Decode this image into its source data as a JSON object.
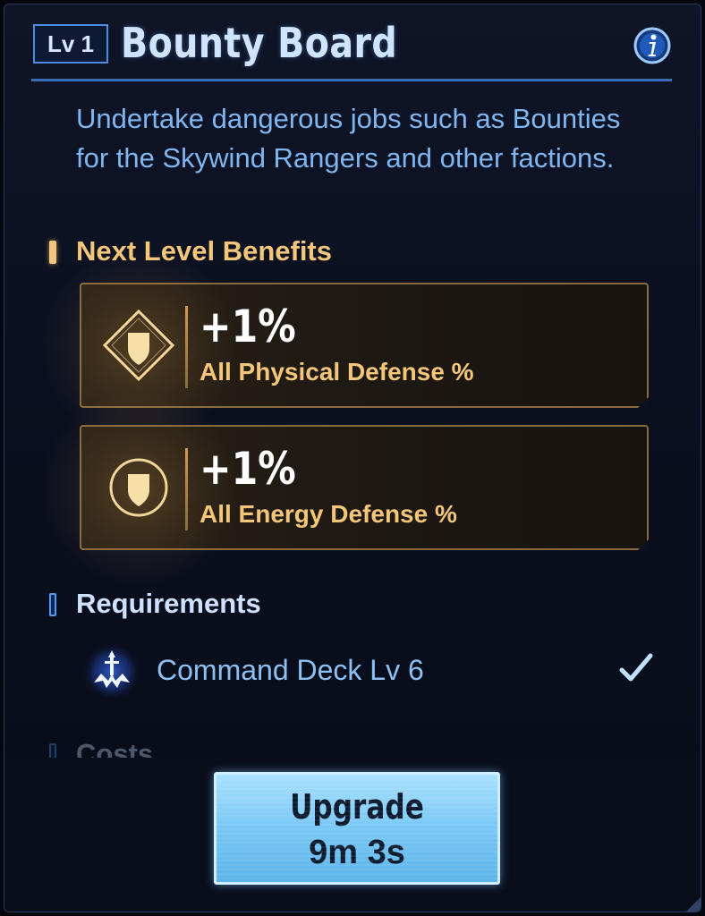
{
  "header": {
    "level_badge": "Lv 1",
    "title": "Bounty Board",
    "info_icon": "info-icon"
  },
  "description": "Undertake dangerous jobs such as Bounties for the Skywind Rangers and other factions.",
  "benefits": {
    "section_title": "Next Level Benefits",
    "items": [
      {
        "value": "+1%",
        "label": "All Physical Defense %",
        "icon": "diamond-shield-icon"
      },
      {
        "value": "+1%",
        "label": "All Energy Defense %",
        "icon": "circle-shield-icon"
      }
    ]
  },
  "requirements": {
    "section_title": "Requirements",
    "items": [
      {
        "label": "Command Deck Lv 6",
        "met": true,
        "icon": "command-deck-icon"
      }
    ]
  },
  "costs": {
    "section_title": "Costs"
  },
  "upgrade_button": {
    "label": "Upgrade",
    "time": "9m 3s"
  },
  "colors": {
    "accent_blue": "#4b8ee0",
    "gold": "#f4c67a",
    "button": "#79c7f5"
  }
}
